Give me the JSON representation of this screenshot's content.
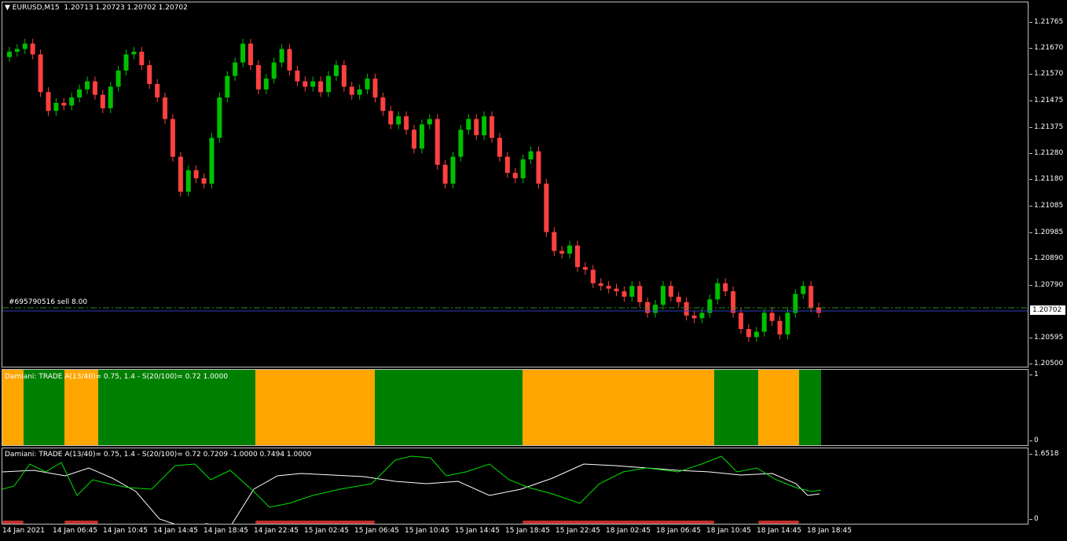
{
  "header": {
    "symbol_label": "EURUSD,M15",
    "ohlc": "1.20713 1.20723 1.20702 1.20702"
  },
  "trade_line": {
    "label": "#695790516 sell 8.00"
  },
  "current_price": "1.20702",
  "price_axis": [
    "1.21765",
    "1.21670",
    "1.21570",
    "1.21475",
    "1.21375",
    "1.21280",
    "1.21180",
    "1.21085",
    "1.20985",
    "1.20890",
    "1.20790",
    "1.20595",
    "1.20500"
  ],
  "indicator1": {
    "label": "Damiani: TRADE  A(13/40)= 0.75, 1.4 - S(20/100)= 0.72  1.0000",
    "scale_top": "1",
    "scale_bottom": "0"
  },
  "indicator2": {
    "label": "Damiani: TRADE  A(13/40)= 0.75, 1.4 - S(20/100)= 0.72  0.7209 -1.0000 0.7494 1.0000",
    "scale_top": "1.6518",
    "scale_bottom": "0"
  },
  "time_axis": [
    "14 Jan 2021",
    "14 Jan 06:45",
    "14 Jan 10:45",
    "14 Jan 14:45",
    "14 Jan 18:45",
    "14 Jan 22:45",
    "15 Jan 02:45",
    "15 Jan 06:45",
    "15 Jan 10:45",
    "15 Jan 14:45",
    "15 Jan 18:45",
    "15 Jan 22:45",
    "18 Jan 02:45",
    "18 Jan 06:45",
    "18 Jan 10:45",
    "18 Jan 14:45",
    "18 Jan 18:45"
  ],
  "colors": {
    "bull": "#00c000",
    "bear": "#ff4040",
    "orange": "#ffa500",
    "green": "#008000",
    "signal_red": "#c0302a",
    "line_green": "#00e000",
    "line_white": "#ffffff",
    "trade_line": "#2a8a2a",
    "bid_line": "#3040c0"
  },
  "chart_data": {
    "type": "candlestick",
    "symbol": "EURUSD",
    "timeframe": "M15",
    "price_range": [
      1.205,
      1.2183
    ],
    "closes": [
      1.2167,
      1.2168,
      1.217,
      1.2166,
      1.2152,
      1.2145,
      1.2148,
      1.2147,
      1.215,
      1.2153,
      1.2156,
      1.2151,
      1.2146,
      1.2154,
      1.216,
      1.2166,
      1.2167,
      1.2162,
      1.2155,
      1.215,
      1.2142,
      1.2128,
      1.2115,
      1.2123,
      1.212,
      1.2118,
      1.2135,
      1.215,
      1.2158,
      1.2163,
      1.217,
      1.2162,
      1.2153,
      1.2157,
      1.2163,
      1.2168,
      1.216,
      1.2156,
      1.2154,
      1.2156,
      1.2152,
      1.2158,
      1.2162,
      1.2154,
      1.2151,
      1.2153,
      1.2157,
      1.215,
      1.2145,
      1.214,
      1.2143,
      1.2138,
      1.2131,
      1.214,
      1.2142,
      1.2125,
      1.2118,
      1.2128,
      1.2138,
      1.2142,
      1.2136,
      1.2143,
      1.2135,
      1.2128,
      1.2122,
      1.212,
      1.2127,
      1.213,
      1.2118,
      1.21,
      1.2093,
      1.2092,
      1.2095,
      1.2087,
      1.2086,
      1.2081,
      1.208,
      1.2079,
      1.2078,
      1.2076,
      1.208,
      1.2074,
      1.207,
      1.2073,
      1.208,
      1.2076,
      1.2074,
      1.2069,
      1.2068,
      1.207,
      1.2075,
      1.2081,
      1.2078,
      1.207,
      1.2064,
      1.2061,
      1.2063,
      1.207,
      1.2067,
      1.2062,
      1.207,
      1.2077,
      1.208,
      1.2072,
      1.207
    ]
  }
}
